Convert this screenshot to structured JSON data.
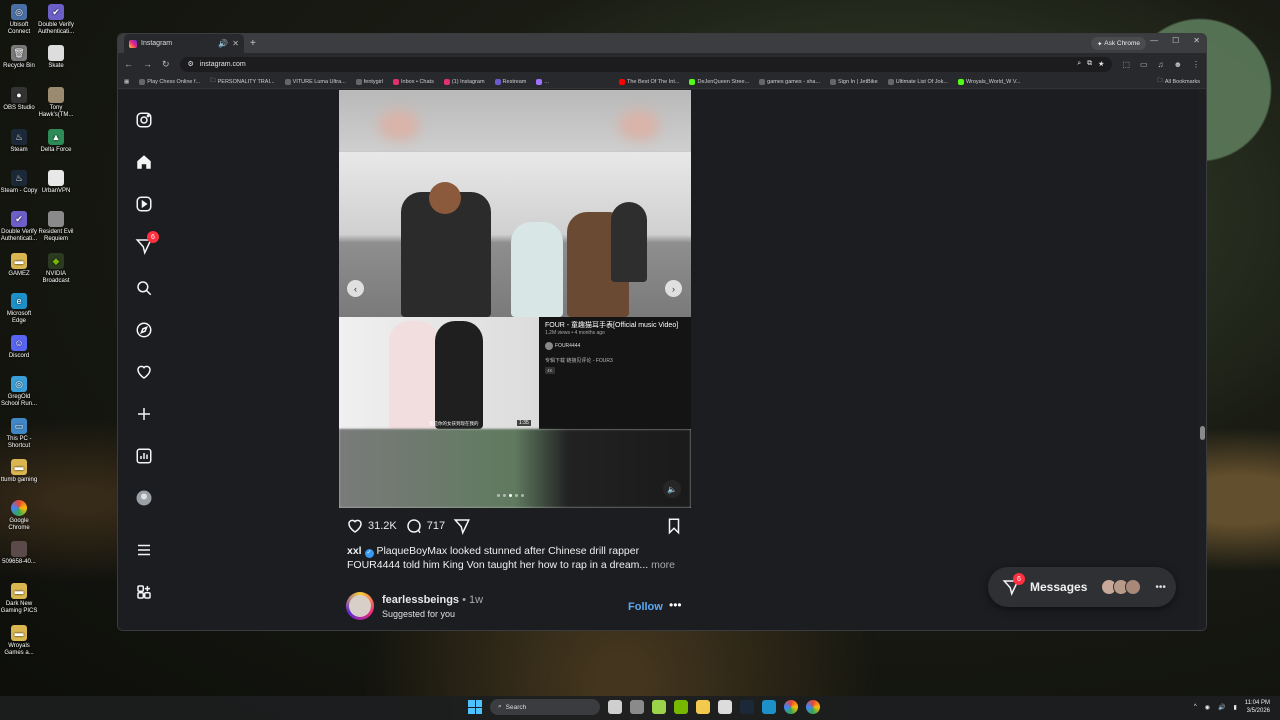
{
  "desktop": {
    "icons": [
      {
        "label": "Ubisoft Connect"
      },
      {
        "label": "Double Verify Authenticati..."
      },
      {
        "label": "Recycle Bin"
      },
      {
        "label": "Skate"
      },
      {
        "label": "OBS Studio"
      },
      {
        "label": "Tony Hawk's(TM..."
      },
      {
        "label": "Steam"
      },
      {
        "label": "Delta Force"
      },
      {
        "label": "Steam - Copy"
      },
      {
        "label": "UrbanVPN"
      },
      {
        "label": "Double Verify Authenticati..."
      },
      {
        "label": "Resident Evil Requiem"
      },
      {
        "label": "GAMEZ"
      },
      {
        "label": "NVIDIA Broadcast"
      },
      {
        "label": "Microsoft Edge"
      },
      {
        "label": "Discord"
      },
      {
        "label": "GregOld School Run..."
      },
      {
        "label": "This PC - Shortcut"
      },
      {
        "label": "ttumb gaming"
      },
      {
        "label": "Google Chrome"
      },
      {
        "label": "509658-40..."
      },
      {
        "label": "Dark New Gaming PICS"
      },
      {
        "label": "Wroyals Games a..."
      }
    ]
  },
  "browser": {
    "tab_title": "Instagram",
    "ask_chrome": "Ask Chrome",
    "url": "instagram.com",
    "bookmarks": [
      "Play Chess Online f...",
      "PERSONALITY TRAI...",
      "VITURE Luma Ultra...",
      "fentygirl",
      "Inbox • Chats",
      "(1) Instagram",
      "Restream",
      "...",
      "The Best Of The Int...",
      "DeJenQueen Stree...",
      "games games - sha...",
      "Sign In | JetBike",
      "Ultimate List Of Jok...",
      "Wroyals_World_W V..."
    ],
    "all_bookmarks": "All Bookmarks"
  },
  "instagram": {
    "notifications_badge": "6",
    "post": {
      "video_title": "FOUR - 童趣猫耳手表[Official music Video]",
      "video_meta": "1.2M views • 4 months ago",
      "video_channel": "FOUR4444",
      "video_desc": "专辑下载 链接见评论 - FOUR3",
      "video_tag": "4K",
      "thumb_duration": "1:35",
      "thumb_subtitle": "我是你的女孩到现在我的",
      "likes": "31.2K",
      "comments": "717",
      "caption_user": "xxl",
      "caption_text": "PlaqueBoyMax looked stunned after Chinese drill rapper FOUR4444 told him King Von taught her how to rap in a dream...",
      "more": "more"
    },
    "next_post": {
      "username": "fearlessbeings",
      "time": "• 1w",
      "subtitle": "Suggested for you",
      "follow": "Follow"
    },
    "messages": {
      "label": "Messages",
      "badge": "6"
    }
  },
  "taskbar": {
    "search": "Search",
    "time": "11:04 PM",
    "date": "3/5/2026"
  }
}
